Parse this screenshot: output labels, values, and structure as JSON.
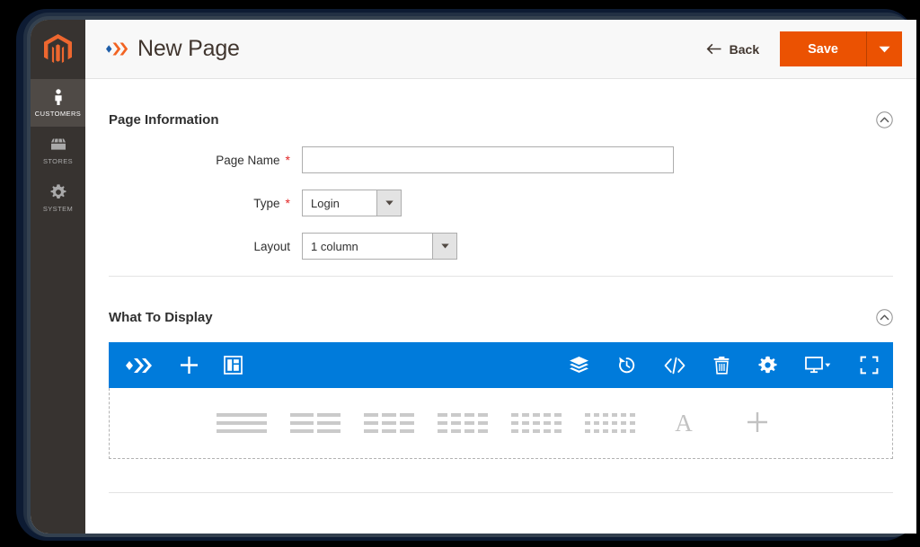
{
  "sidebar": {
    "logo_icon": "magento-hexagon-logo",
    "items": [
      {
        "label": "CUSTOMERS",
        "icon": "customers-person-icon",
        "active": true
      },
      {
        "label": "STORES",
        "icon": "stores-storefront-icon",
        "active": false
      },
      {
        "label": "SYSTEM",
        "icon": "system-gear-icon",
        "active": false
      }
    ]
  },
  "header": {
    "page_builder_icon": "page-builder-chevrons-icon",
    "title": "New Page",
    "back_label": "Back",
    "back_icon": "arrow-left-icon",
    "save_label": "Save",
    "save_caret_icon": "caret-down-icon",
    "accent_orange": "#eb5202"
  },
  "sections": [
    {
      "title": "Page Information",
      "collapse_icon": "chevron-up-circle-icon"
    },
    {
      "title": "What To Display",
      "collapse_icon": "chevron-up-circle-icon"
    }
  ],
  "form": {
    "page_name": {
      "label": "Page Name",
      "required": "*",
      "value": "",
      "placeholder": ""
    },
    "type": {
      "label": "Type",
      "required": "*",
      "value": "Login",
      "options": [
        "Login"
      ]
    },
    "layout": {
      "label": "Layout",
      "required": "",
      "value": "1 column",
      "options": [
        "1 column"
      ]
    }
  },
  "page_builder": {
    "toolbar_color": "#007bdb",
    "left_tools": [
      {
        "name": "page-builder-logo-icon",
        "label": "Page Builder"
      },
      {
        "name": "add-icon",
        "label": "Add"
      },
      {
        "name": "template-layout-icon",
        "label": "Templates"
      }
    ],
    "right_tools": [
      {
        "name": "layers-stack-icon",
        "label": "Layers"
      },
      {
        "name": "history-undo-icon",
        "label": "History"
      },
      {
        "name": "code-icon",
        "label": "Code"
      },
      {
        "name": "trash-icon",
        "label": "Delete"
      },
      {
        "name": "gear-icon",
        "label": "Settings"
      },
      {
        "name": "desktop-viewport-icon",
        "label": "Viewport"
      },
      {
        "name": "fullscreen-icon",
        "label": "Full Screen"
      }
    ],
    "content_items": [
      {
        "name": "column-layout-1-icon",
        "columns": 1,
        "label": "1 Column"
      },
      {
        "name": "column-layout-2-icon",
        "columns": 2,
        "label": "2 Columns"
      },
      {
        "name": "column-layout-3-icon",
        "columns": 3,
        "label": "3 Columns"
      },
      {
        "name": "column-layout-4-icon",
        "columns": 4,
        "label": "4 Columns"
      },
      {
        "name": "column-layout-5-icon",
        "columns": 5,
        "label": "5 Columns"
      },
      {
        "name": "column-layout-6-icon",
        "columns": 6,
        "label": "6 Columns"
      },
      {
        "name": "text-letter-a-icon",
        "letter": "A",
        "label": "Text"
      },
      {
        "name": "add-plus-icon",
        "label": "Add Content"
      }
    ]
  }
}
